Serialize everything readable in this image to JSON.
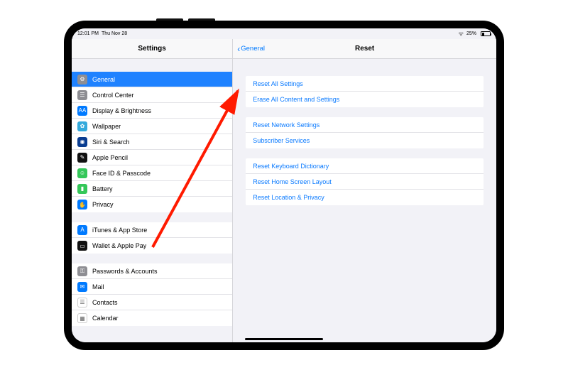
{
  "statusbar": {
    "time": "12:01 PM",
    "date": "Thu Nov 28",
    "battery_pct": "25%"
  },
  "sidebar": {
    "title": "Settings",
    "groups": [
      [
        {
          "label": "General",
          "icon": "gear-icon",
          "color": "gray",
          "selected": true
        },
        {
          "label": "Control Center",
          "icon": "switches-icon",
          "color": "gray"
        },
        {
          "label": "Display & Brightness",
          "icon": "brightness-icon",
          "color": "blue"
        },
        {
          "label": "Wallpaper",
          "icon": "flower-icon",
          "color": "teal"
        },
        {
          "label": "Siri & Search",
          "icon": "siri-icon",
          "color": "darkblue"
        },
        {
          "label": "Apple Pencil",
          "icon": "pencil-icon",
          "color": "black"
        },
        {
          "label": "Face ID & Passcode",
          "icon": "faceid-icon",
          "color": "green"
        },
        {
          "label": "Battery",
          "icon": "battery-icon",
          "color": "green"
        },
        {
          "label": "Privacy",
          "icon": "hand-icon",
          "color": "blue"
        }
      ],
      [
        {
          "label": "iTunes & App Store",
          "icon": "appstore-icon",
          "color": "blue"
        },
        {
          "label": "Wallet & Apple Pay",
          "icon": "wallet-icon",
          "color": "black"
        }
      ],
      [
        {
          "label": "Passwords & Accounts",
          "icon": "key-icon",
          "color": "gray"
        },
        {
          "label": "Mail",
          "icon": "mail-icon",
          "color": "blue"
        },
        {
          "label": "Contacts",
          "icon": "contacts-icon",
          "color": "white"
        },
        {
          "label": "Calendar",
          "icon": "calendar-icon",
          "color": "white"
        }
      ]
    ]
  },
  "detail": {
    "back_label": "General",
    "title": "Reset",
    "groups": [
      [
        {
          "label": "Reset All Settings"
        },
        {
          "label": "Erase All Content and Settings"
        }
      ],
      [
        {
          "label": "Reset Network Settings"
        },
        {
          "label": "Subscriber Services"
        }
      ],
      [
        {
          "label": "Reset Keyboard Dictionary"
        },
        {
          "label": "Reset Home Screen Layout"
        },
        {
          "label": "Reset Location & Privacy"
        }
      ]
    ]
  },
  "annotation": {
    "arrow_target": "Reset All Settings"
  }
}
